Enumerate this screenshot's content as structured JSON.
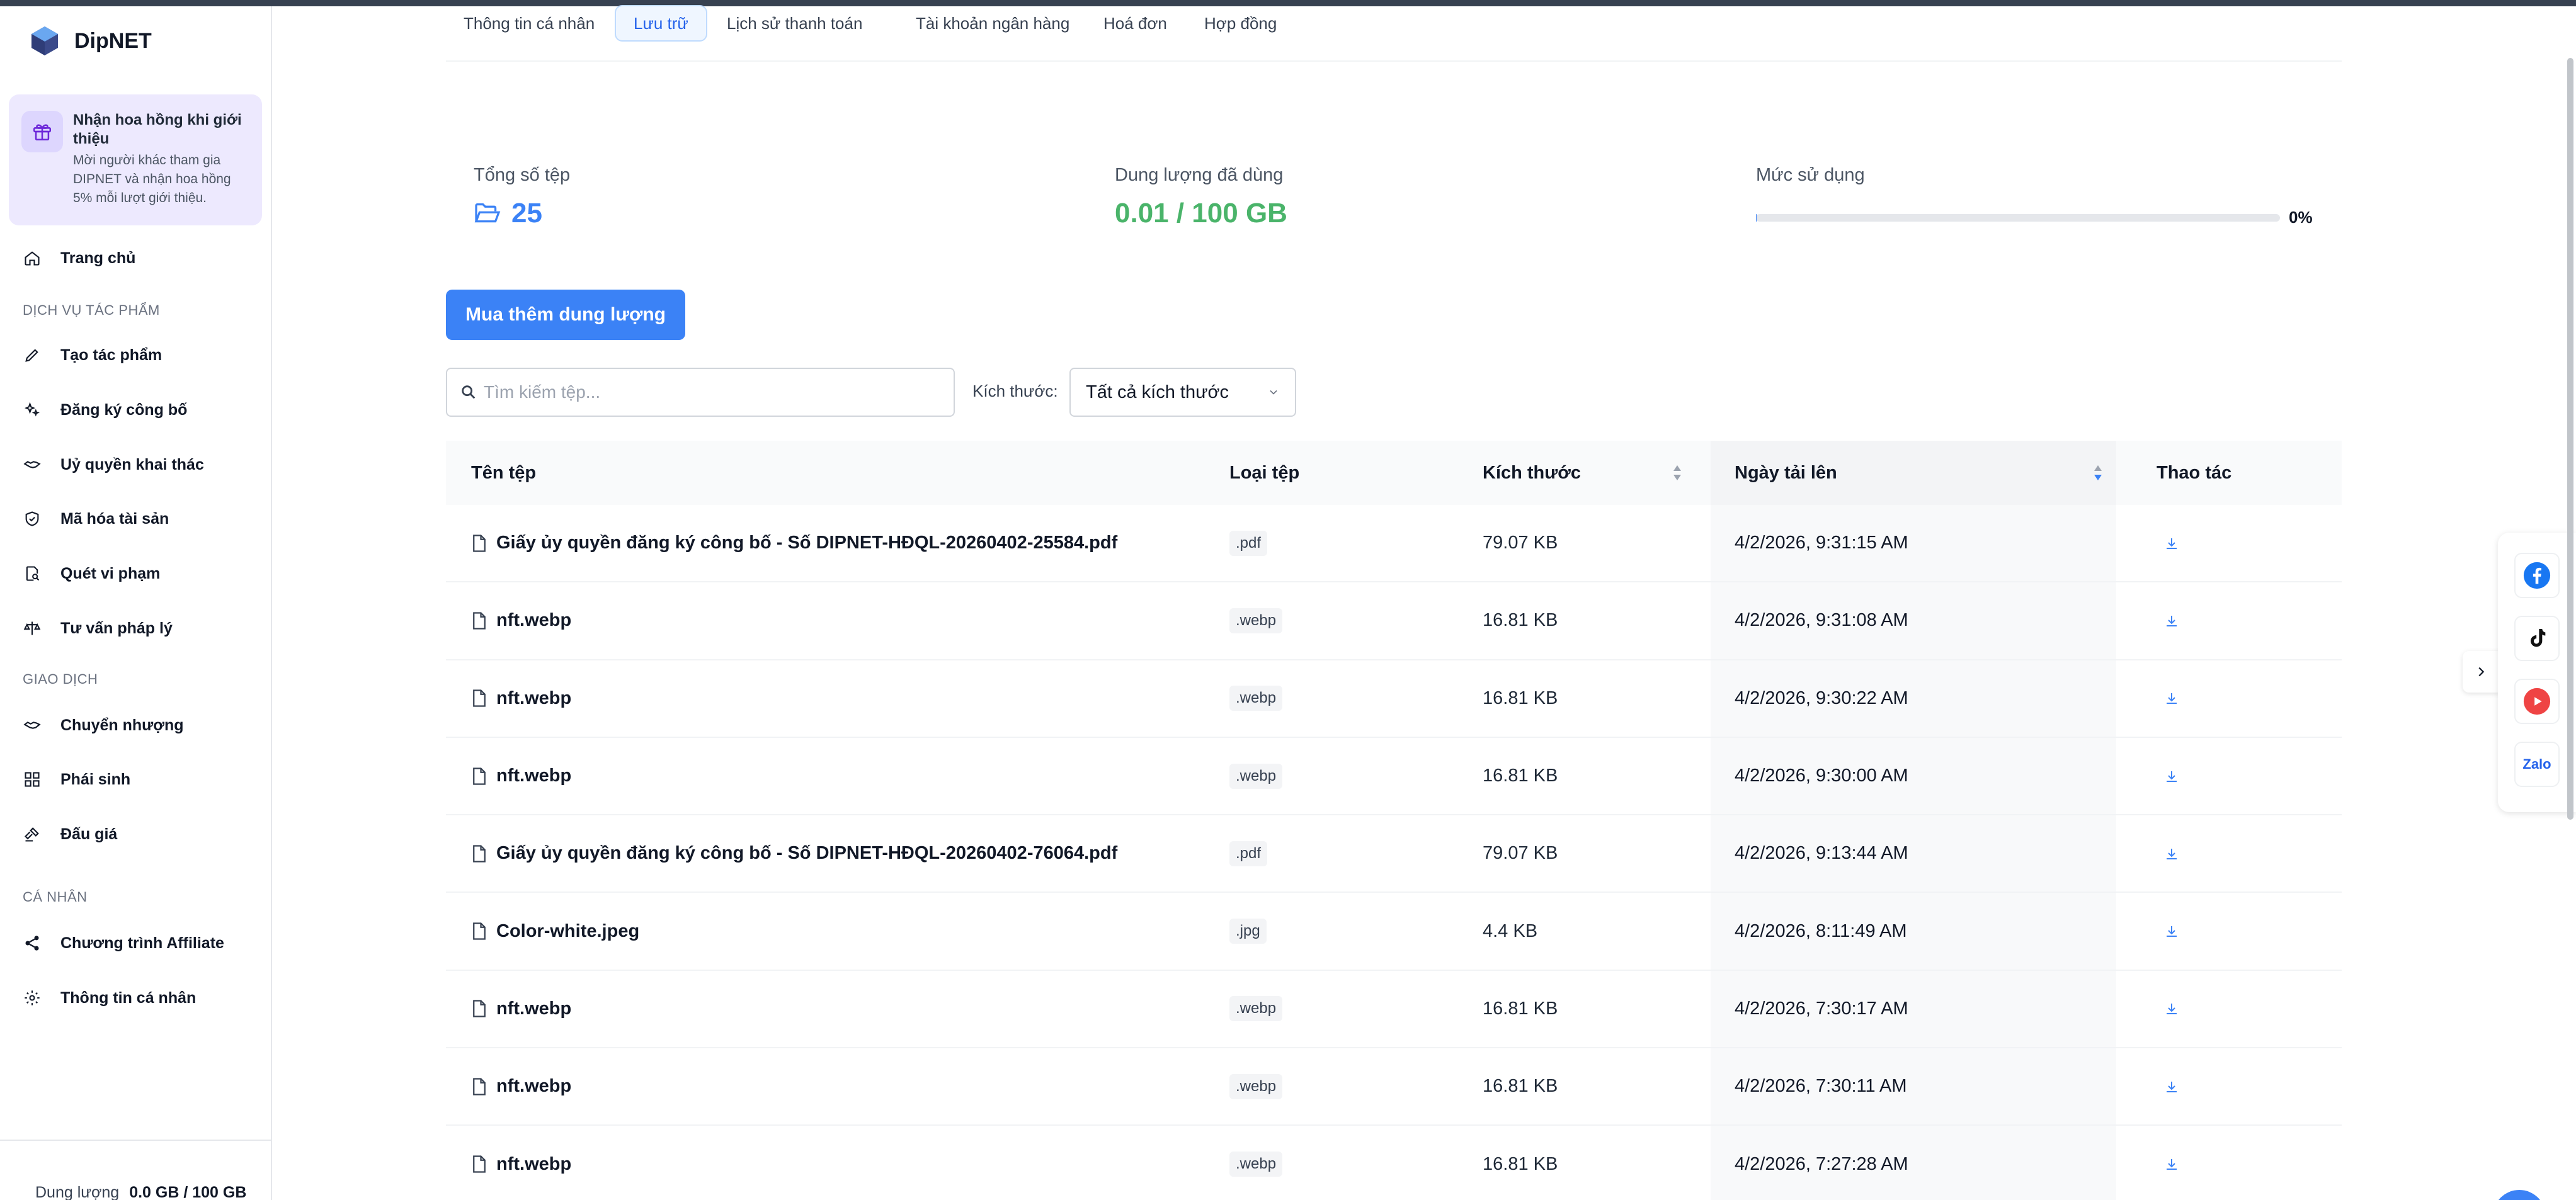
{
  "brand": {
    "name": "DipNET",
    "accent": "#3b82f6"
  },
  "sidebar": {
    "promo": {
      "title": "Nhận hoa hồng khi giới thiệu",
      "description": "Mời người khác tham gia DIPNET và nhận hoa hồng 5% mỗi lượt giới thiệu."
    },
    "home": {
      "label": "Trang chủ",
      "icon": "home-icon"
    },
    "sections": [
      {
        "title": "DỊCH VỤ TÁC PHẨM",
        "items": [
          {
            "label": "Tạo tác phẩm",
            "icon": "pencil-icon"
          },
          {
            "label": "Đăng ký công bố",
            "icon": "sparkles-icon"
          },
          {
            "label": "Uỷ quyền khai thác",
            "icon": "handshake-icon"
          },
          {
            "label": "Mã hóa tài sản",
            "icon": "shield-check-icon"
          },
          {
            "label": "Quét vi phạm",
            "icon": "document-search-icon"
          },
          {
            "label": "Tư vấn pháp lý",
            "icon": "scale-icon"
          }
        ]
      },
      {
        "title": "GIAO DỊCH",
        "items": [
          {
            "label": "Chuyển nhượng",
            "icon": "handshake-icon"
          },
          {
            "label": "Phái sinh",
            "icon": "grid-icon"
          },
          {
            "label": "Đấu giá",
            "icon": "gavel-icon"
          }
        ]
      },
      {
        "title": "CÁ NHÂN",
        "items": [
          {
            "label": "Chương trình Affiliate",
            "icon": "share-icon"
          },
          {
            "label": "Thông tin cá nhân",
            "icon": "gear-icon"
          }
        ]
      }
    ],
    "storage": {
      "label": "Dung lượng",
      "value": "0.0 GB / 100 GB"
    }
  },
  "tabs": [
    {
      "label": "Thông tin cá nhân",
      "active": false
    },
    {
      "label": "Lưu trữ",
      "active": true
    },
    {
      "label": "Lịch sử thanh toán",
      "active": false
    },
    {
      "label": "Tài khoản ngân hàng",
      "active": false
    },
    {
      "label": "Hoá đơn",
      "active": false
    },
    {
      "label": "Hợp đồng",
      "active": false
    }
  ],
  "stats": {
    "total_files_label": "Tổng số tệp",
    "total_files_value": "25",
    "used_label": "Dung lượng đã dùng",
    "used_value": "0.01 / 100 GB",
    "usage_label": "Mức sử dụng",
    "usage_percent_text": "0%",
    "usage_fraction": 0.0001
  },
  "buy_button": "Mua thêm dung lượng",
  "filters": {
    "search_placeholder": "Tìm kiếm tệp...",
    "size_label": "Kích thước:",
    "size_value": "Tất cả kích thước"
  },
  "table": {
    "headers": {
      "name": "Tên tệp",
      "type": "Loại tệp",
      "size": "Kích thước",
      "date": "Ngày tải lên",
      "action": "Thao tác"
    },
    "rows": [
      {
        "name": "Giấy ủy quyền đăng ký công bố - Số DIPNET-HĐQL-20260402-25584.pdf",
        "type": ".pdf",
        "size": "79.07 KB",
        "date": "4/2/2026, 9:31:15 AM"
      },
      {
        "name": "nft.webp",
        "type": ".webp",
        "size": "16.81 KB",
        "date": "4/2/2026, 9:31:08 AM"
      },
      {
        "name": "nft.webp",
        "type": ".webp",
        "size": "16.81 KB",
        "date": "4/2/2026, 9:30:22 AM"
      },
      {
        "name": "nft.webp",
        "type": ".webp",
        "size": "16.81 KB",
        "date": "4/2/2026, 9:30:00 AM"
      },
      {
        "name": "Giấy ủy quyền đăng ký công bố - Số DIPNET-HĐQL-20260402-76064.pdf",
        "type": ".pdf",
        "size": "79.07 KB",
        "date": "4/2/2026, 9:13:44 AM"
      },
      {
        "name": "Color-white.jpeg",
        "type": ".jpg",
        "size": "4.4 KB",
        "date": "4/2/2026, 8:11:49 AM"
      },
      {
        "name": "nft.webp",
        "type": ".webp",
        "size": "16.81 KB",
        "date": "4/2/2026, 7:30:17 AM"
      },
      {
        "name": "nft.webp",
        "type": ".webp",
        "size": "16.81 KB",
        "date": "4/2/2026, 7:30:11 AM"
      },
      {
        "name": "nft.webp",
        "type": ".webp",
        "size": "16.81 KB",
        "date": "4/2/2026, 7:27:28 AM"
      }
    ]
  },
  "social": {
    "items": [
      {
        "icon": "facebook-icon",
        "color": "#1877f2"
      },
      {
        "icon": "tiktok-icon",
        "color": "#111111"
      },
      {
        "icon": "youtube-icon",
        "color": "#ef4444"
      },
      {
        "icon": "zalo-icon",
        "label": "Zalo",
        "color": "#2563eb"
      }
    ]
  }
}
